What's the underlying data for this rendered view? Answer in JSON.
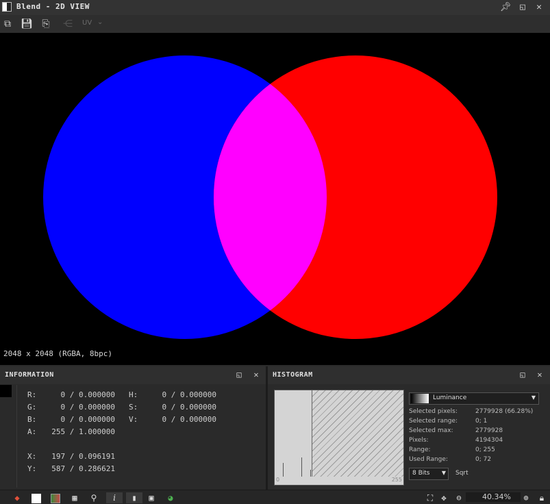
{
  "window": {
    "title": "Blend - 2D VIEW"
  },
  "toolbar": {
    "uv_label": "UV",
    "uv_chevron": "⌄"
  },
  "viewport": {
    "dimensions": "2048 x 2048 (RGBA, 8bpc)",
    "colors": {
      "left_circle": "#0000ff",
      "right_circle": "#ff0000",
      "overlap": "#ff00ff",
      "background": "#000000"
    }
  },
  "information": {
    "title": "INFORMATION",
    "rows": [
      {
        "label": "R:",
        "value": "0 / 0.000000"
      },
      {
        "label": "G:",
        "value": "0 / 0.000000"
      },
      {
        "label": "B:",
        "value": "0 / 0.000000"
      },
      {
        "label": "A:",
        "value": "255 / 1.000000"
      },
      {
        "label": "X:",
        "value": "197 / 0.096191"
      },
      {
        "label": "Y:",
        "value": "587 / 0.286621"
      }
    ],
    "hsv": [
      {
        "label": "H:",
        "value": "0 / 0.000000"
      },
      {
        "label": "S:",
        "value": "0 / 0.000000"
      },
      {
        "label": "V:",
        "value": "0 / 0.000000"
      }
    ]
  },
  "histogram": {
    "title": "HISTOGRAM",
    "channel": "Luminance",
    "axis_min": "0",
    "axis_max": "255",
    "stats": [
      {
        "label": "Selected pixels:",
        "value": "2779928 (66.28%)"
      },
      {
        "label": "Selected range:",
        "value": "0; 1"
      },
      {
        "label": "Selected max:",
        "value": "2779928"
      },
      {
        "label": "Pixels:",
        "value": "4194304"
      },
      {
        "label": "Range:",
        "value": "0; 255"
      },
      {
        "label": "Used Range:",
        "value": "0; 72"
      }
    ],
    "bits": "8 Bits",
    "sqrt_label": "Sqrt"
  },
  "statusbar": {
    "zoom": "40.34%"
  },
  "icons": [
    "checker-icon",
    "pin-icon",
    "restore-icon",
    "close-icon",
    "export-icon",
    "save-icon",
    "copy-icon",
    "graph-icon",
    "layers-icon",
    "white-swatch-icon",
    "gradient-swatch-icon",
    "grid-icon",
    "pick-icon",
    "info-icon",
    "histogram-icon",
    "image-icon",
    "color-wheel-icon",
    "fit-icon",
    "move-icon",
    "zoom-out-icon",
    "zoom-in-icon",
    "lock-icon"
  ]
}
